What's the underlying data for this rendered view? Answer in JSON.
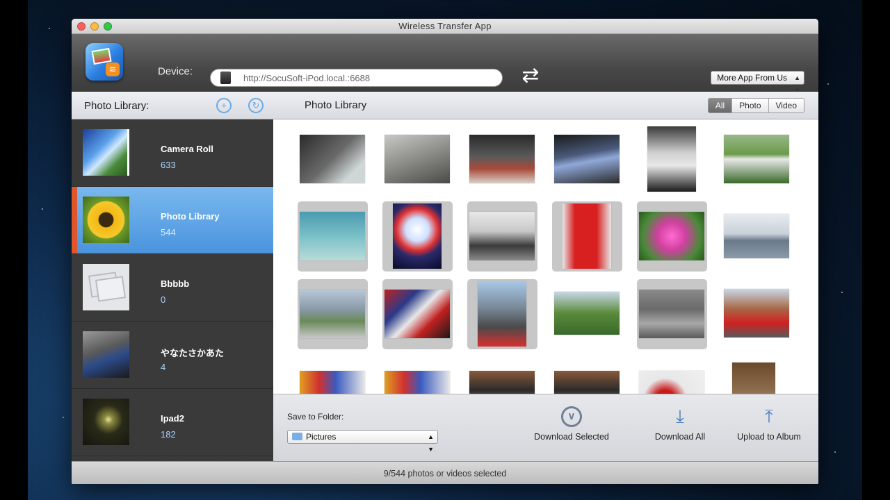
{
  "window": {
    "title": "Wireless Transfer App"
  },
  "toolbar": {
    "device_label": "Device:",
    "device_url": "http://SocuSoft-iPod.local.:6688",
    "more_app_label": "More App From Us"
  },
  "sidebar": {
    "title": "Photo Library:",
    "albums": [
      {
        "name": "Camera Roll",
        "count": "633",
        "selected": false
      },
      {
        "name": "Photo Library",
        "count": "544",
        "selected": true
      },
      {
        "name": "Bbbbb",
        "count": "0",
        "selected": false
      },
      {
        "name": "やなたさかあた",
        "count": "4",
        "selected": false
      },
      {
        "name": "Ipad2",
        "count": "182",
        "selected": false
      }
    ]
  },
  "content": {
    "title": "Photo Library",
    "filters": [
      "All",
      "Photo",
      "Video"
    ],
    "active_filter": "All"
  },
  "bottom": {
    "save_to_label": "Save to Folder:",
    "folder_value": "Pictures",
    "download_selected_label": "Download Selected",
    "download_all_label": "Download All",
    "upload_label": "Upload to Album"
  },
  "status": {
    "text": "9/544 photos or videos selected"
  },
  "colors": {
    "accent_selected": "#4a94dd",
    "selection_marker": "#e0552a"
  }
}
